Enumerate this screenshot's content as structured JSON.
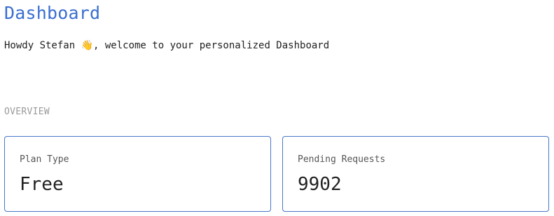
{
  "header": {
    "title": "Dashboard",
    "greeting": "Howdy Stefan 👋, welcome to your personalized Dashboard"
  },
  "overview": {
    "section_label": "OVERVIEW",
    "cards": [
      {
        "label": "Plan Type",
        "value": "Free"
      },
      {
        "label": "Pending Requests",
        "value": "9902"
      }
    ]
  },
  "colors": {
    "title": "#3a6fd0",
    "card_border": "#4a76c9",
    "section_label": "#9a9a9a"
  }
}
